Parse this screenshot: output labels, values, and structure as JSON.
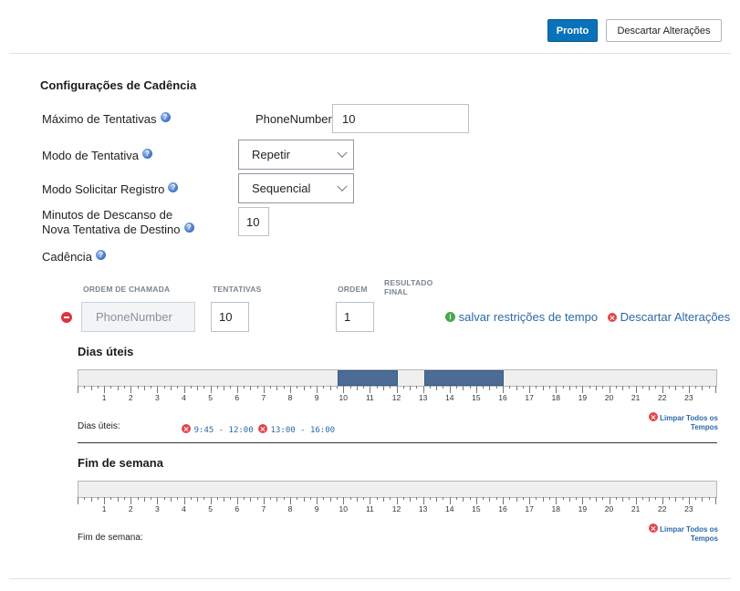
{
  "header": {
    "done_label": "Pronto",
    "discard_label": "Descartar Alterações"
  },
  "cadence_settings": {
    "title": "Configurações de Cadência",
    "max_attempts_label": "Máximo de Tentativas",
    "phone_number_label": "PhoneNumber",
    "phone_number_value": "10",
    "attempt_mode_label": "Modo de Tentativa",
    "attempt_mode_value": "Repetir",
    "request_record_mode_label": "Modo Solicitar Registro",
    "request_record_mode_value": "Sequencial",
    "rest_minutes_label_line1": "Minutos de Descanso de",
    "rest_minutes_label_line2": "Nova Tentativa de Destino",
    "rest_minutes_value": "10",
    "cadence_label": "Cadência"
  },
  "cadence_table": {
    "col_call_order": "ORDEM DE CHAMADA",
    "col_attempts": "TENTATIVAS",
    "col_order": "ORDEM",
    "col_final_result_line1": "RESULTADO",
    "col_final_result_line2": "FINAL",
    "row": {
      "call_order": "PhoneNumber",
      "attempts": "10",
      "order": "1"
    },
    "save_time_restrictions": "salvar restrições de tempo",
    "discard_changes": "Descartar Alterações"
  },
  "weekdays": {
    "title": "Dias úteis",
    "summary_label": "Dias úteis:",
    "ranges": [
      {
        "label": "9:45 - 12:00",
        "start": 9.75,
        "end": 12.0
      },
      {
        "label": "13:00 - 16:00",
        "start": 13.0,
        "end": 16.0
      }
    ],
    "clear_all_line1": "Limpar Todos os",
    "clear_all_line2": "Tempos"
  },
  "weekend": {
    "title": "Fim de semana",
    "summary_label": "Fim de semana:",
    "ranges": [],
    "clear_all_line1": "Limpar Todos os",
    "clear_all_line2": "Tempos"
  },
  "hours": [
    "1",
    "2",
    "3",
    "4",
    "5",
    "6",
    "7",
    "8",
    "9",
    "10",
    "11",
    "12",
    "13",
    "14",
    "15",
    "16",
    "17",
    "18",
    "19",
    "20",
    "21",
    "22",
    "23"
  ],
  "colors": {
    "primary": "#0a72b9",
    "range_fill": "#4c6c95",
    "link": "#2b6aa8",
    "remove": "#e4444b",
    "info": "#4aa84a"
  }
}
